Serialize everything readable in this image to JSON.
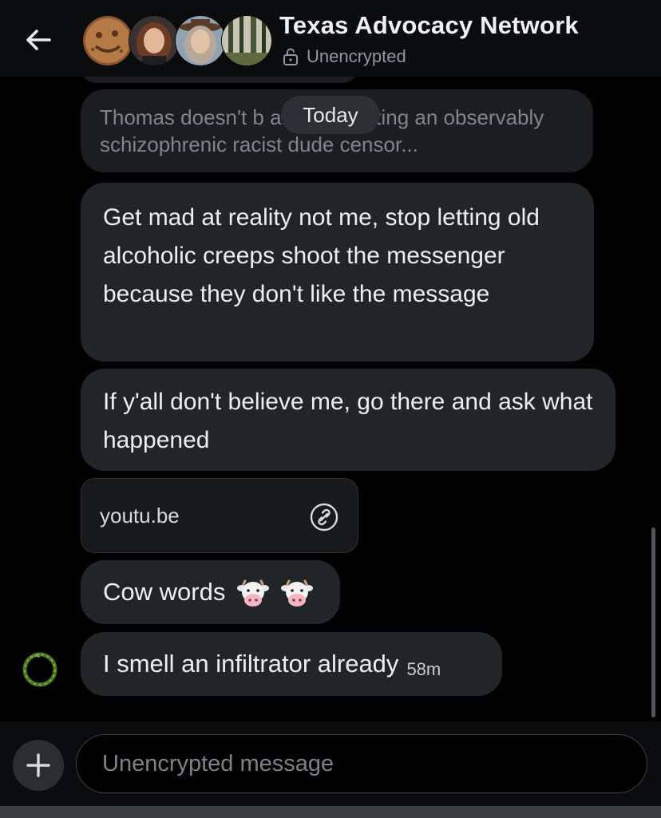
{
  "header": {
    "title": "Texas Advocacy Network",
    "status": "Unencrypted",
    "back_icon": "arrow-left-icon",
    "lock_icon": "lock-open-icon"
  },
  "chat": {
    "date_separator": "Today",
    "quoted_message": "Thomas doesn't b and he's letting an observably schizophrenic racist dude censor...",
    "messages": [
      {
        "text": "Get mad at reality not me, stop letting old alcoholic creeps shoot the messenger because they don't like the message"
      },
      {
        "text": "If y'all don't believe me, go there and ask what happened"
      },
      {
        "link": "youtu.be",
        "icon": "link-icon"
      },
      {
        "text": "Cow words"
      },
      {
        "text": "I smell an infiltrator already",
        "time": "58m"
      }
    ]
  },
  "composer": {
    "placeholder": "Unencrypted message",
    "add_icon": "plus-icon"
  },
  "colors": {
    "background": "#000000",
    "bubble": "#222528",
    "header": "#0b0c0d",
    "muted_text": "#8b98a5"
  }
}
